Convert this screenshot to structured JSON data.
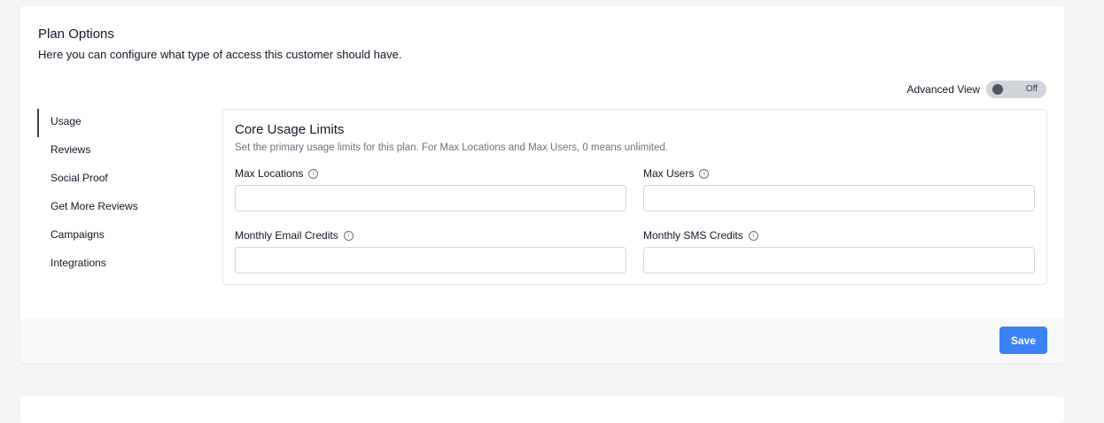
{
  "plan_options": {
    "title": "Plan Options",
    "subtitle": "Here you can configure what type of access this customer should have."
  },
  "advanced_view": {
    "label": "Advanced View",
    "toggle_state": "Off"
  },
  "nav": {
    "items": [
      {
        "label": "Usage",
        "active": true
      },
      {
        "label": "Reviews",
        "active": false
      },
      {
        "label": "Social Proof",
        "active": false
      },
      {
        "label": "Get More Reviews",
        "active": false
      },
      {
        "label": "Campaigns",
        "active": false
      },
      {
        "label": "Integrations",
        "active": false
      }
    ]
  },
  "core_usage": {
    "title": "Core Usage Limits",
    "description": "Set the primary usage limits for this plan. For Max Locations and Max Users, 0 means unlimited.",
    "fields": [
      {
        "label": "Max Locations",
        "value": ""
      },
      {
        "label": "Max Users",
        "value": ""
      },
      {
        "label": "Monthly Email Credits",
        "value": ""
      },
      {
        "label": "Monthly SMS Credits",
        "value": ""
      }
    ]
  },
  "footer": {
    "save_label": "Save"
  },
  "colors": {
    "accent": "#3b82f6",
    "page_background": "#f3f4f6"
  },
  "icons": {
    "info": "info-icon"
  }
}
